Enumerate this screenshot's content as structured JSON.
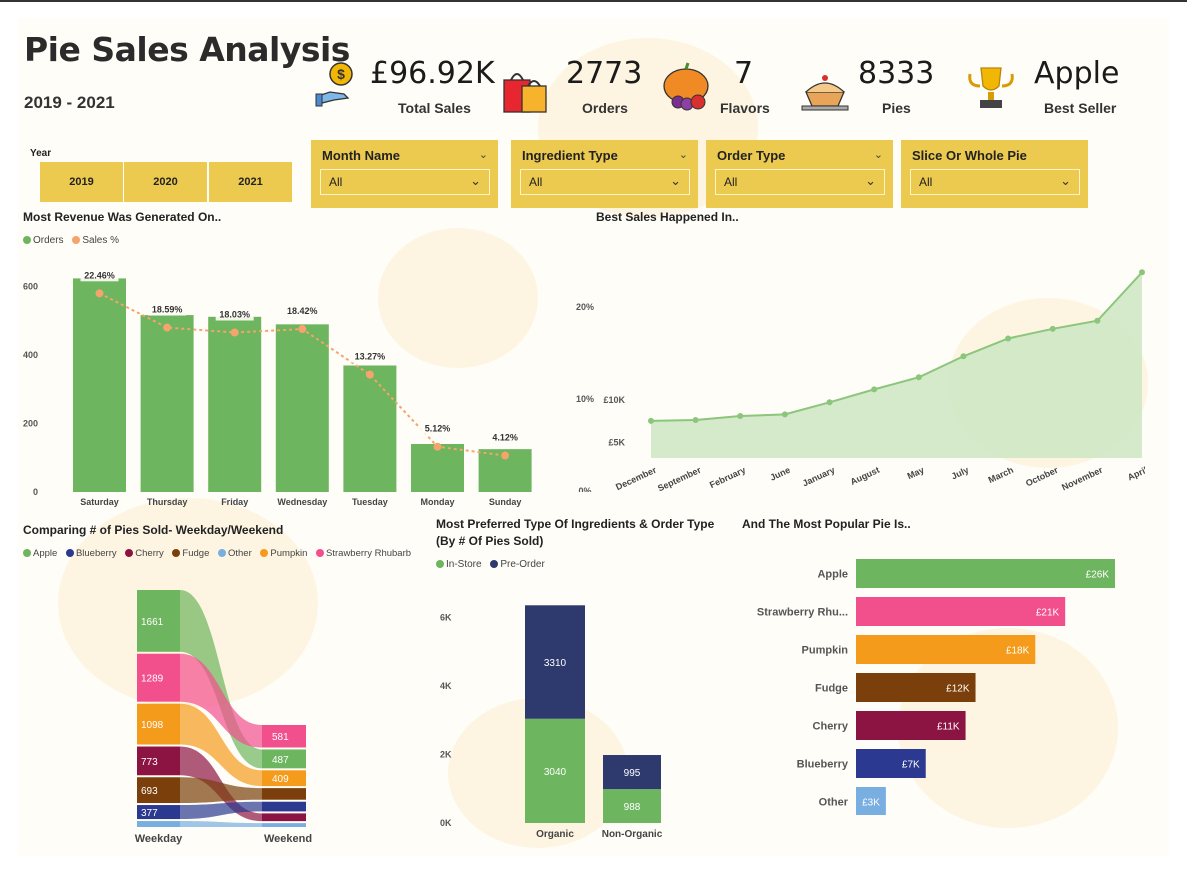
{
  "header": {
    "title": "Pie Sales Analysis",
    "years": "2019 - 2021"
  },
  "kpis": [
    {
      "value": "£96.92K",
      "label": "Total Sales",
      "icon": "money-hand-icon"
    },
    {
      "value": "2773",
      "label": "Orders",
      "icon": "shopping-bags-icon"
    },
    {
      "value": "7",
      "label": "Flavors",
      "icon": "pumpkin-harvest-icon"
    },
    {
      "value": "8333",
      "label": "Pies",
      "icon": "pie-icon"
    },
    {
      "value": "Apple",
      "label": "Best Seller",
      "icon": "trophy-icon"
    }
  ],
  "year_filter": {
    "caption": "Year",
    "options": [
      "2019",
      "2020",
      "2021"
    ]
  },
  "slicers": [
    {
      "title": "Month Name",
      "value": "All"
    },
    {
      "title": "Ingredient Type",
      "value": "All"
    },
    {
      "title": "Order Type",
      "value": "All"
    },
    {
      "title": "Slice Or Whole Pie",
      "value": "All"
    }
  ],
  "colors": {
    "accent": "#ecc94f",
    "green": "#6db55e",
    "orange": "#f4a46c",
    "navy": "#2e3a6e",
    "apple": "#6db55e",
    "blueberry": "#2b3990",
    "cherry": "#8c1442",
    "fudge": "#7a3f0a",
    "other": "#78aee0",
    "pumpkin": "#f59b1c",
    "strawberry_rhubarb": "#f24f8d"
  },
  "chart_data": [
    {
      "type": "bar",
      "title": "Most Revenue Was Generated On..",
      "categories": [
        "Saturday",
        "Thursday",
        "Friday",
        "Wednesday",
        "Tuesday",
        "Monday",
        "Sunday"
      ],
      "series": [
        {
          "name": "Orders",
          "values": [
            623,
            516,
            511,
            489,
            369,
            140,
            125
          ]
        },
        {
          "name": "Sales %",
          "values": [
            22.46,
            18.59,
            18.03,
            18.42,
            13.27,
            5.12,
            4.12
          ],
          "labels": [
            "22.46%",
            "18.59%",
            "18.03%",
            "18.42%",
            "13.27%",
            "5.12%",
            "4.12%"
          ]
        }
      ],
      "y_ticks": [
        "0",
        "200",
        "400",
        "600"
      ],
      "ylim": [
        0,
        700
      ]
    },
    {
      "type": "area",
      "title": "Best Sales Happened In..",
      "categories": [
        "December",
        "September",
        "February",
        "June",
        "January",
        "August",
        "May",
        "July",
        "March",
        "October",
        "November",
        "April"
      ],
      "values": [
        4.6,
        4.7,
        5.2,
        5.4,
        6.9,
        8.5,
        10.0,
        12.6,
        14.8,
        16.0,
        17.0,
        23.0
      ],
      "left_ticks": [
        "£5K",
        "£10K"
      ],
      "right_ticks": [
        "0%",
        "10%",
        "20%"
      ],
      "ylim": [
        0,
        27
      ]
    },
    {
      "type": "sankey",
      "title": "Comparing # of Pies Sold- Weekday/Weekend",
      "legend": [
        "Apple",
        "Blueberry",
        "Cherry",
        "Fudge",
        "Other",
        "Pumpkin",
        "Strawberry Rhubarb"
      ],
      "categories": [
        "Weekday",
        "Weekend"
      ],
      "weekday": [
        {
          "name": "Apple",
          "value": 1661,
          "label": "1661"
        },
        {
          "name": "Strawberry Rhubarb",
          "value": 1289,
          "label": "1289"
        },
        {
          "name": "Pumpkin",
          "value": 1098,
          "label": "1098"
        },
        {
          "name": "Cherry",
          "value": 773,
          "label": "773"
        },
        {
          "name": "Fudge",
          "value": 693,
          "label": "693"
        },
        {
          "name": "Blueberry",
          "value": 377,
          "label": "377"
        },
        {
          "name": "Other",
          "value": 160,
          "label": ""
        }
      ],
      "weekend": [
        {
          "name": "Strawberry Rhubarb",
          "value": 581,
          "label": "581"
        },
        {
          "name": "Apple",
          "value": 487,
          "label": "487"
        },
        {
          "name": "Pumpkin",
          "value": 409,
          "label": "409"
        },
        {
          "name": "Fudge",
          "value": 300,
          "label": ""
        },
        {
          "name": "Blueberry",
          "value": 250,
          "label": ""
        },
        {
          "name": "Cherry",
          "value": 200,
          "label": ""
        },
        {
          "name": "Other",
          "value": 100,
          "label": ""
        }
      ]
    },
    {
      "type": "bar",
      "title": "Most Preferred Type Of Ingredients & Order Type",
      "subtitle": "(By # Of Pies Sold)",
      "stacked": true,
      "categories": [
        "Organic",
        "Non-Organic"
      ],
      "series": [
        {
          "name": "In-Store",
          "values": [
            3040,
            988
          ]
        },
        {
          "name": "Pre-Order",
          "values": [
            3310,
            995
          ]
        }
      ],
      "y_ticks": [
        "0K",
        "2K",
        "4K",
        "6K"
      ],
      "ylim": [
        0,
        7000
      ]
    },
    {
      "type": "bar",
      "orientation": "horizontal",
      "title": "And The Most Popular Pie Is..",
      "categories": [
        "Apple",
        "Strawberry Rhu...",
        "Pumpkin",
        "Fudge",
        "Cherry",
        "Blueberry",
        "Other"
      ],
      "values": [
        26,
        21,
        18,
        12,
        11,
        7,
        3
      ],
      "labels": [
        "£26K",
        "£21K",
        "£18K",
        "£12K",
        "£11K",
        "£7K",
        "£3K"
      ],
      "xlim": [
        0,
        26
      ]
    }
  ]
}
